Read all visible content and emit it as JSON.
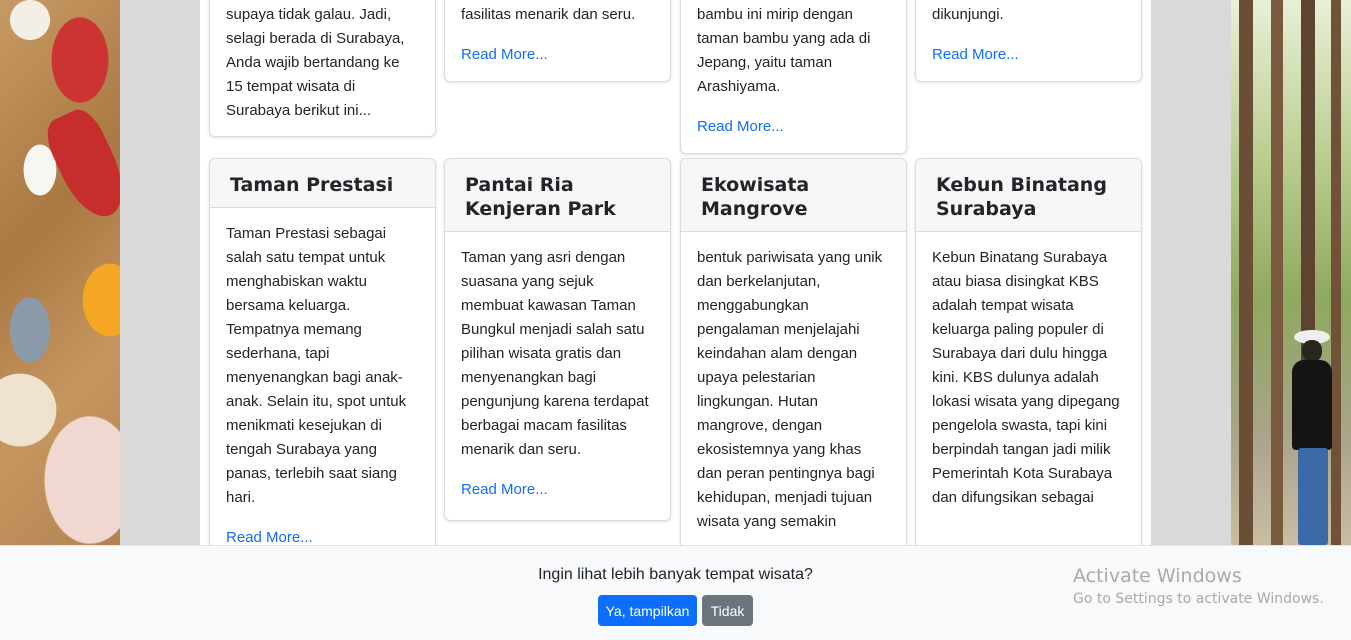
{
  "top_cards": [
    {
      "text_lines": [
        "supaya tidak galau. Jadi,",
        "selagi berada di Surabaya,",
        "Anda wajib bertandang ke",
        "15 tempat wisata di",
        "Surabaya berikut ini..."
      ]
    },
    {
      "text_lines": [
        "fasilitas menarik dan seru."
      ],
      "read_more": "Read More..."
    },
    {
      "text_lines": [
        "bambu ini mirip dengan",
        "taman bambu yang ada di",
        "Jepang, yaitu taman",
        "Arashiyama."
      ],
      "read_more": "Read More..."
    },
    {
      "text_lines": [
        "dikunjungi."
      ],
      "read_more": "Read More..."
    }
  ],
  "cards": [
    {
      "title": "Taman Prestasi",
      "text": "Taman Prestasi sebagai salah satu tempat untuk menghabiskan waktu bersama keluarga. Tempatnya memang sederhana, tapi menyenangkan bagi anak-anak. Selain itu, spot untuk menikmati kesejukan di tengah Surabaya yang panas, terlebih saat siang hari.",
      "read_more": "Read More..."
    },
    {
      "title": "Pantai Ria Kenjeran Park",
      "text": "Taman yang asri dengan suasana yang sejuk membuat kawasan Taman Bungkul menjadi salah satu pilihan wisata gratis dan menyenangkan bagi pengunjung karena terdapat berbagai macam fasilitas menarik dan seru.",
      "read_more": "Read More..."
    },
    {
      "title": "Ekowisata Mangrove",
      "text": "bentuk pariwisata yang unik dan berkelanjutan, menggabungkan pengalaman menjelajahi keindahan alam dengan upaya pelestarian lingkungan. Hutan mangrove, dengan ekosistemnya yang khas dan peran pentingnya bagi kehidupan, menjadi tujuan wisata yang semakin"
    },
    {
      "title": "Kebun Binatang Surabaya",
      "text": "Kebun Binatang Surabaya atau biasa disingkat KBS adalah tempat wisata keluarga paling populer di Surabaya dari dulu hingga kini. KBS dulunya adalah lokasi wisata yang dipegang pengelola swasta, tapi kini berpindah tangan jadi milik Pemerintah Kota Surabaya dan difungsikan sebagai"
    }
  ],
  "bottom_bar": {
    "prompt": "Ingin lihat lebih banyak tempat wisata?",
    "yes_label": "Ya, tampilkan",
    "no_label": "Tidak"
  },
  "windows_watermark": {
    "title": "Activate Windows",
    "subtitle": "Go to Settings to activate Windows."
  }
}
